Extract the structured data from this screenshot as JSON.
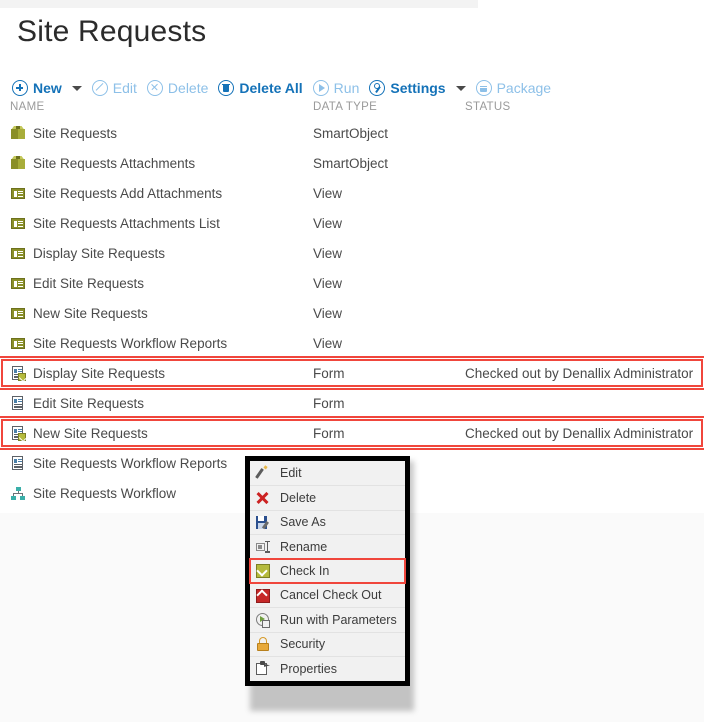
{
  "page": {
    "title": "Site Requests",
    "accent_blue": "#1472b8",
    "highlight_red": "#f0463c",
    "disabled_blue": "#8dc0e8"
  },
  "toolbar": {
    "items": [
      {
        "label": "New",
        "icon": "plus-circle-icon",
        "enabled": true,
        "has_caret": true
      },
      {
        "label": "Edit",
        "icon": "edit-circle-icon",
        "enabled": false,
        "has_caret": false
      },
      {
        "label": "Delete",
        "icon": "delete-circle-icon",
        "enabled": false,
        "has_caret": false
      },
      {
        "label": "Delete All",
        "icon": "trash-circle-icon",
        "enabled": true,
        "has_caret": false
      },
      {
        "label": "Run",
        "icon": "play-circle-icon",
        "enabled": false,
        "has_caret": false
      },
      {
        "label": "Settings",
        "icon": "settings-circle-icon",
        "enabled": true,
        "has_caret": true
      },
      {
        "label": "Package",
        "icon": "package-circle-icon",
        "enabled": false,
        "has_caret": false
      }
    ]
  },
  "columns": {
    "name": "NAME",
    "data_type": "DATA TYPE",
    "status": "STATUS"
  },
  "rows": [
    {
      "name": "Site Requests",
      "type": "SmartObject",
      "status": "",
      "icon": "smartobject-icon",
      "highlighted": false
    },
    {
      "name": "Site Requests Attachments",
      "type": "SmartObject",
      "status": "",
      "icon": "smartobject-icon",
      "highlighted": false
    },
    {
      "name": "Site Requests Add Attachments",
      "type": "View",
      "status": "",
      "icon": "view-icon",
      "highlighted": false
    },
    {
      "name": "Site Requests Attachments List",
      "type": "View",
      "status": "",
      "icon": "view-icon",
      "highlighted": false
    },
    {
      "name": "Display Site Requests",
      "type": "View",
      "status": "",
      "icon": "view-icon",
      "highlighted": false
    },
    {
      "name": "Edit Site Requests",
      "type": "View",
      "status": "",
      "icon": "view-icon",
      "highlighted": false
    },
    {
      "name": "New Site Requests",
      "type": "View",
      "status": "",
      "icon": "view-icon",
      "highlighted": false
    },
    {
      "name": "Site Requests Workflow Reports",
      "type": "View",
      "status": "",
      "icon": "view-icon",
      "highlighted": false
    },
    {
      "name": "Display Site Requests",
      "type": "Form",
      "status": "Checked out by Denallix Administrator",
      "icon": "form-checkedout-icon",
      "highlighted": true
    },
    {
      "name": "Edit Site Requests",
      "type": "Form",
      "status": "",
      "icon": "form-icon",
      "highlighted": false
    },
    {
      "name": "New Site Requests",
      "type": "Form",
      "status": "Checked out by Denallix Administrator",
      "icon": "form-checkedout-icon",
      "highlighted": true
    },
    {
      "name": "Site Requests Workflow Reports",
      "type": "",
      "status": "",
      "icon": "form-icon",
      "highlighted": false
    },
    {
      "name": "Site Requests Workflow",
      "type": "",
      "status": "",
      "icon": "workflow-icon",
      "highlighted": false
    }
  ],
  "context_menu": {
    "items": [
      {
        "label": "Edit",
        "icon": "pencil-icon",
        "selected": false
      },
      {
        "label": "Delete",
        "icon": "red-x-icon",
        "selected": false
      },
      {
        "label": "Save As",
        "icon": "floppy-disk-icon",
        "selected": false
      },
      {
        "label": "Rename",
        "icon": "rename-icon",
        "selected": false
      },
      {
        "label": "Check In",
        "icon": "check-in-arrow-icon",
        "selected": true
      },
      {
        "label": "Cancel Check Out",
        "icon": "cancel-checkout-icon",
        "selected": false
      },
      {
        "label": "Run with Parameters",
        "icon": "run-parameters-icon",
        "selected": false
      },
      {
        "label": "Security",
        "icon": "padlock-icon",
        "selected": false
      },
      {
        "label": "Properties",
        "icon": "properties-icon",
        "selected": false
      }
    ]
  }
}
